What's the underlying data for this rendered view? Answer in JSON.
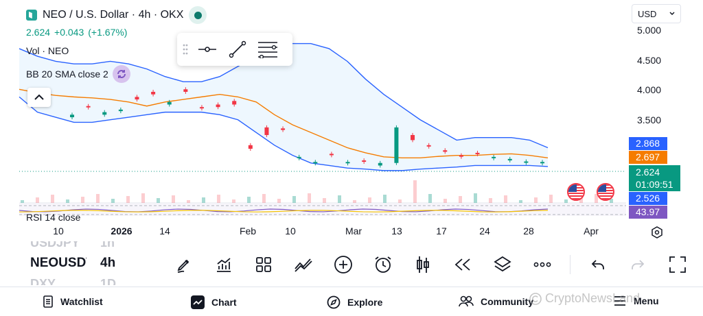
{
  "header": {
    "title": "NEO / U.S. Dollar · 4h · OKX",
    "last": "2.624",
    "change": "+0.043",
    "change_pct": "(+1.67%)",
    "up_color": "#089981",
    "down_color": "#f23645"
  },
  "indicators": {
    "volume": "Vol · NEO",
    "bollinger": "BB 20 SMA close 2",
    "rsi": "RSI 14 close"
  },
  "currency": {
    "selected": "USD"
  },
  "price_axis": {
    "ticks": [
      {
        "label": "5.000",
        "value": 5.0
      },
      {
        "label": "4.500",
        "value": 4.5
      },
      {
        "label": "4.000",
        "value": 4.0
      },
      {
        "label": "3.500",
        "value": 3.5
      }
    ],
    "tags": {
      "bb_upper": {
        "label": "2.868",
        "color": "#2962ff"
      },
      "bb_basis": {
        "label": "2.697",
        "color": "#f57c00"
      },
      "last_price": {
        "label": "2.624",
        "color": "#089981"
      },
      "countdown": "01:09:51",
      "bb_lower": {
        "label": "2.526",
        "color": "#2962ff"
      },
      "rsi": {
        "label": "43.97",
        "color": "#7e57c2"
      }
    }
  },
  "time_axis": [
    {
      "label": "10",
      "bold": false
    },
    {
      "label": "2026",
      "bold": true
    },
    {
      "label": "14",
      "bold": false
    },
    {
      "label": "Feb",
      "bold": false
    },
    {
      "label": "10",
      "bold": false
    },
    {
      "label": "Mar",
      "bold": false
    },
    {
      "label": "13",
      "bold": false
    },
    {
      "label": "17",
      "bold": false
    },
    {
      "label": "24",
      "bold": false
    },
    {
      "label": "28",
      "bold": false
    },
    {
      "label": "Apr",
      "bold": false
    }
  ],
  "chart_data": {
    "type": "candlestick",
    "bollinger": {
      "upper": [
        4.85,
        4.7,
        4.6,
        4.55,
        4.55,
        4.6,
        4.55,
        4.45,
        4.3,
        4.2,
        4.2,
        4.3,
        4.5,
        4.7,
        4.9,
        4.95,
        4.95,
        4.85,
        4.6,
        4.25,
        3.95,
        3.7,
        3.45,
        3.25,
        3.05,
        3.1,
        3.1,
        3.1,
        3.05,
        2.9
      ],
      "basis": [
        4.05,
        3.98,
        3.93,
        3.9,
        3.88,
        3.85,
        3.8,
        3.72,
        3.8,
        3.85,
        3.9,
        3.95,
        3.9,
        3.8,
        3.55,
        3.35,
        3.2,
        3.05,
        2.9,
        2.8,
        2.72,
        2.7,
        2.7,
        2.73,
        2.75,
        2.75,
        2.77,
        2.78,
        2.75,
        2.7
      ],
      "lower": [
        3.9,
        3.6,
        3.5,
        3.4,
        3.4,
        3.45,
        3.5,
        3.55,
        3.6,
        3.6,
        3.6,
        3.55,
        3.45,
        3.2,
        2.95,
        2.75,
        2.6,
        2.55,
        2.5,
        2.48,
        2.45,
        2.45,
        2.48,
        2.5,
        2.52,
        2.55,
        2.55,
        2.55,
        2.55,
        2.53
      ]
    },
    "candles": [
      {
        "o": 3.5,
        "c": 3.55
      },
      {
        "o": 3.72,
        "c": 3.7
      },
      {
        "o": 3.55,
        "c": 3.6
      },
      {
        "o": 3.62,
        "c": 3.65
      },
      {
        "o": 3.9,
        "c": 3.85
      },
      {
        "o": 4.0,
        "c": 3.95
      },
      {
        "o": 3.75,
        "c": 3.8
      },
      {
        "o": 4.05,
        "c": 4.0
      },
      {
        "o": 3.7,
        "c": 3.68
      },
      {
        "o": 3.75,
        "c": 3.7
      },
      {
        "o": 3.82,
        "c": 3.75
      },
      {
        "o": 2.95,
        "c": 2.88
      },
      {
        "o": 3.3,
        "c": 3.15
      },
      {
        "o": 3.28,
        "c": 3.25
      },
      {
        "o": 2.7,
        "c": 2.72
      },
      {
        "o": 2.6,
        "c": 2.62
      },
      {
        "o": 2.78,
        "c": 2.76
      },
      {
        "o": 2.6,
        "c": 2.62
      },
      {
        "o": 2.65,
        "c": 2.63
      },
      {
        "o": 2.55,
        "c": 2.6
      },
      {
        "o": 2.6,
        "c": 3.3
      },
      {
        "o": 3.15,
        "c": 3.05
      },
      {
        "o": 2.95,
        "c": 2.93
      },
      {
        "o": 2.85,
        "c": 2.82
      },
      {
        "o": 2.75,
        "c": 2.74
      },
      {
        "o": 2.8,
        "c": 2.78
      },
      {
        "o": 2.7,
        "c": 2.72
      },
      {
        "o": 2.65,
        "c": 2.68
      },
      {
        "o": 2.62,
        "c": 2.63
      },
      {
        "o": 2.6,
        "c": 2.62
      }
    ],
    "y_range": [
      2.3,
      5.2
    ]
  },
  "tools": {
    "draw_toolbar": [
      "horizontal-ray-tool",
      "trend-line-tool",
      "fib-retracement-tool"
    ],
    "main_toolbar": [
      "brush",
      "indicators",
      "layouts",
      "compare",
      "add",
      "alert",
      "candles",
      "replay",
      "layers",
      "more",
      "undo",
      "redo",
      "fullscreen"
    ]
  },
  "symbols": {
    "prev": "USDJPY",
    "current": "NEOUSDT",
    "next": "DXY",
    "tf_prev": "1h",
    "tf_current": "4h",
    "tf_next": "1D"
  },
  "nav": {
    "watchlist": "Watchlist",
    "chart": "Chart",
    "explore": "Explore",
    "community": "Community",
    "menu": "Menu"
  },
  "watermark": "CryptoNewsLand"
}
